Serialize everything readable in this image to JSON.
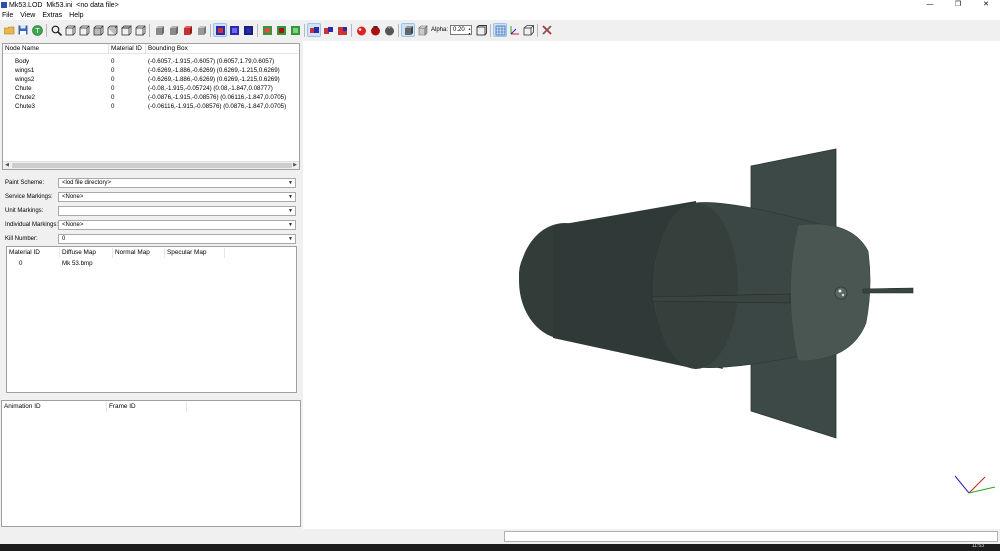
{
  "window": {
    "title": "Mk53.LOD  Mk53.ini  <no data file>",
    "minimize": "—",
    "restore": "❐",
    "close": "✕"
  },
  "menu": [
    "File",
    "View",
    "Extras",
    "Help"
  ],
  "toolbar": {
    "alpha_label": "Alpha:",
    "alpha_value": "0.20"
  },
  "node_list": {
    "columns": [
      "Node Name",
      "Material ID",
      "Bounding Box"
    ],
    "rows": [
      {
        "name": "Body",
        "material": "0",
        "bbox": "(-0.6057,-1.915,-0.6057) (0.6057,1.79,0.6057)"
      },
      {
        "name": "wings1",
        "material": "0",
        "bbox": "(-0.6269,-1.886,-0.6269) (0.6269,-1.215,0.6269)"
      },
      {
        "name": "wings2",
        "material": "0",
        "bbox": "(-0.6269,-1.886,-0.6269) (0.6269,-1.215,0.6269)"
      },
      {
        "name": "Chute",
        "material": "0",
        "bbox": "(-0.08,-1.915,-0.05724) (0.08,-1.847,0.08777)"
      },
      {
        "name": "Chute2",
        "material": "0",
        "bbox": "(-0.0876,-1.915,-0.08576) (0.06116,-1.847,0.0705)"
      },
      {
        "name": "Chute3",
        "material": "0",
        "bbox": "(-0.06116,-1.915,-0.08576) (0.0876,-1.847,0.0705)"
      }
    ]
  },
  "properties": {
    "paint_scheme": {
      "label": "Paint Scheme:",
      "value": "<lod file directory>"
    },
    "service_markings": {
      "label": "Service Markings:",
      "value": "<None>"
    },
    "unit_markings": {
      "label": "Unit Markings:",
      "value": ""
    },
    "individual_markings": {
      "label": "Individual Markings:",
      "value": "<None>"
    },
    "kill_number": {
      "label": "Kill Number:",
      "value": "0"
    }
  },
  "material_list": {
    "columns": [
      "Material ID",
      "Diffuse Map",
      "Normal Map",
      "Specular Map"
    ],
    "rows": [
      {
        "id": "0",
        "diffuse": "Mk 53.bmp",
        "normal": "",
        "specular": ""
      }
    ]
  },
  "animation_list": {
    "columns": [
      "Animation ID",
      "Frame ID"
    ]
  },
  "status": {
    "text": ""
  },
  "taskbar": {
    "clock": "11:53"
  },
  "colors": {
    "model_dark": "#2f3a37",
    "model_mid": "#3c4845",
    "model_light": "#4b5753",
    "axis_x": "#cc2020",
    "axis_y": "#22aa22",
    "axis_z": "#2222cc"
  }
}
